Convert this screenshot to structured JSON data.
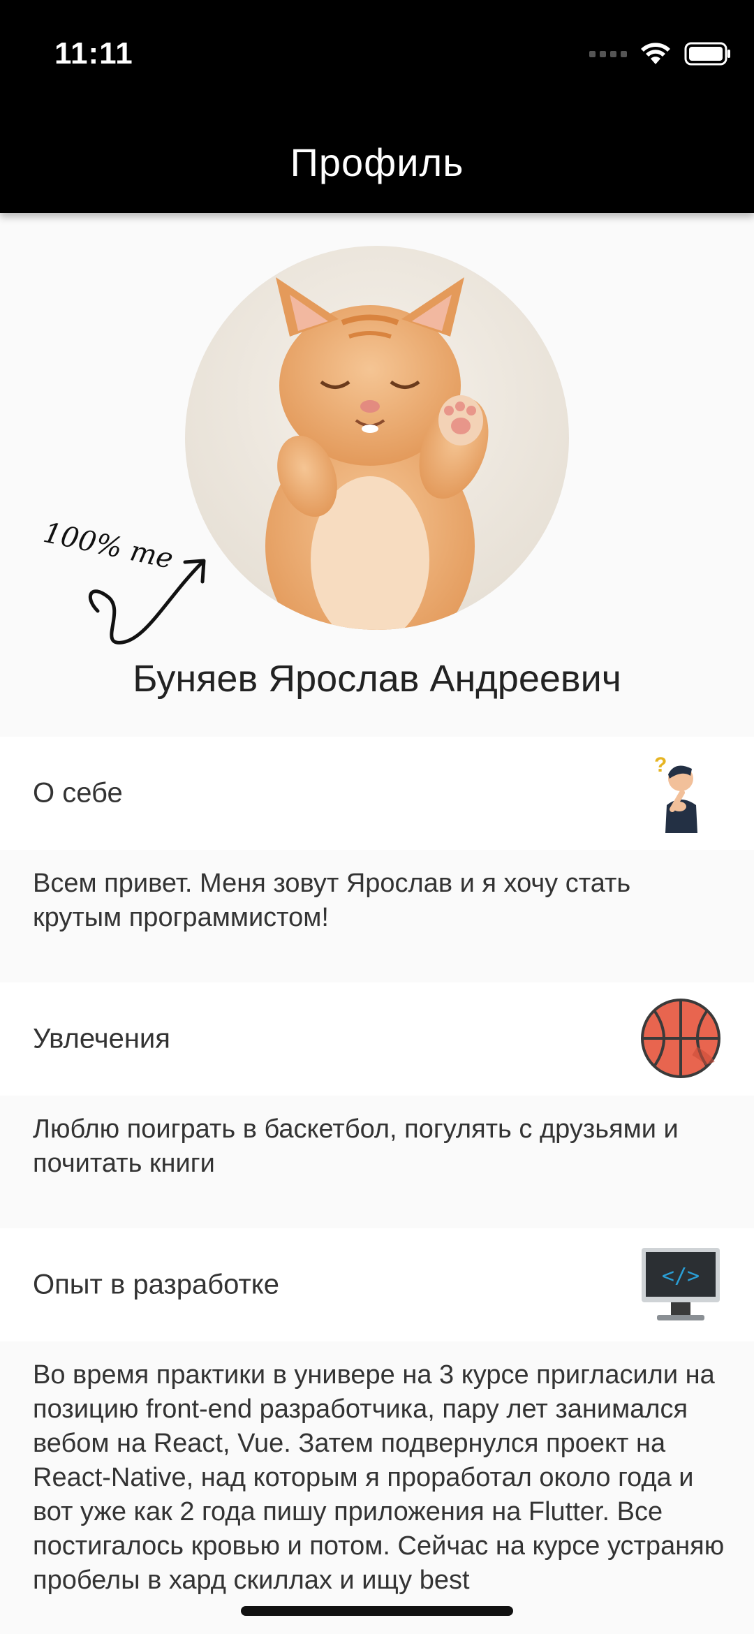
{
  "status_bar": {
    "time": "11:11"
  },
  "app_bar": {
    "title": "Профиль"
  },
  "profile": {
    "name": "Буняев Ярослав Андреевич",
    "avatar_annotation": "100% me"
  },
  "sections": [
    {
      "title": "О себе",
      "icon": "thinking-person-icon",
      "text": "Всем привет. Меня зовут Ярослав и я хочу стать крутым программистом!"
    },
    {
      "title": "Увлечения",
      "icon": "basketball-icon",
      "text": "Люблю поиграть в баскетбол, погулять с друзьями и почитать книги"
    },
    {
      "title": "Опыт в разработке",
      "icon": "code-monitor-icon",
      "text": "Во время практики в универе на 3 курсе пригласили на позицию front-end разработчика, пару лет занимался вебом на React, Vue. Затем подвернулся проект на React-Native, над которым я проработал около года и вот уже как 2 года пишу приложения на Flutter. Все постигалось кровью и потом. Сейчас на курсе устраняю пробелы в хард скиллах и ищу best"
    }
  ],
  "colors": {
    "app_bar": "#000000",
    "background": "#fafafa",
    "row": "#ffffff",
    "basketball": "#e8654f",
    "code_accent": "#2a9fd6"
  }
}
